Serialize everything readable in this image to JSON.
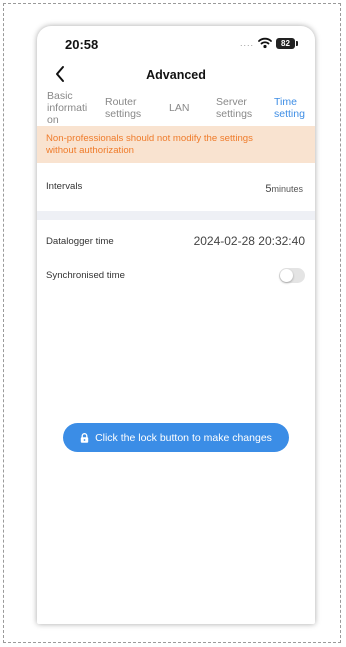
{
  "status_bar": {
    "time": "20:58",
    "signal_dots": "....",
    "battery": "82"
  },
  "nav": {
    "title": "Advanced"
  },
  "tabs": [
    {
      "label_lines": [
        "Basic",
        "informati",
        "on"
      ],
      "active": false
    },
    {
      "label_lines": [
        "Router",
        "settings"
      ],
      "active": false
    },
    {
      "label_lines": [
        "LAN"
      ],
      "active": false
    },
    {
      "label_lines": [
        "Server",
        "settings"
      ],
      "active": false
    },
    {
      "label_lines": [
        "Time",
        "setting"
      ],
      "active": true
    }
  ],
  "warning": {
    "line1": "Non-professionals should not modify the settings",
    "line2": "without authorization"
  },
  "intervals": {
    "label": "Intervals",
    "value": "5",
    "unit": "minutes"
  },
  "datalogger": {
    "label": "Datalogger time",
    "value": "2024-02-28 20:32:40"
  },
  "sync": {
    "label": "Synchronised time",
    "enabled": false
  },
  "lock_button": {
    "label": "Click the lock button to make changes"
  },
  "colors": {
    "accent": "#3b8de6",
    "warning_bg": "#f9e3d0",
    "warning_text": "#ef7b2a"
  }
}
